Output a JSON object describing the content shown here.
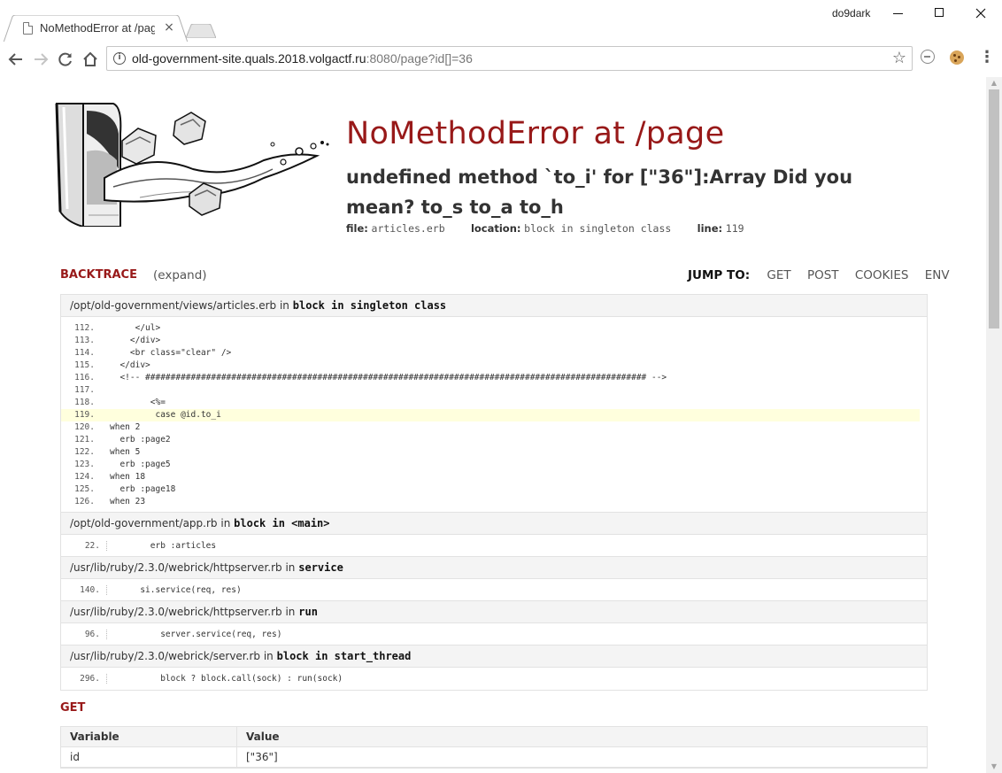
{
  "browser": {
    "tab_title": "NoMethodError at /page",
    "tab_close": "×",
    "user": "do9dark",
    "url_host": "old-government-site.quals.2018.volgactf.ru",
    "url_rest": ":8080/page?id[]=36"
  },
  "error": {
    "title": "NoMethodError at /page",
    "message": "undefined method `to_i' for [\"36\"]:Array Did you mean? to_s to_a to_h",
    "file_label": "file:",
    "file": "articles.erb",
    "location_label": "location:",
    "location": "block in singleton class",
    "line_label": "line:",
    "line": "119"
  },
  "backtrace": {
    "heading": "BACKTRACE",
    "expand": "(expand)",
    "jump_label": "JUMP TO:",
    "jump_links": [
      "GET",
      "POST",
      "COOKIES",
      "ENV"
    ],
    "frames": [
      {
        "file": "/opt/old-government/views/articles.erb",
        "in": "in",
        "method": "block in singleton class",
        "lines": [
          {
            "no": "112.",
            "code": "     </ul>"
          },
          {
            "no": "113.",
            "code": "    </div>"
          },
          {
            "no": "114.",
            "code": "    <br class=\"clear\" />"
          },
          {
            "no": "115.",
            "code": "  </div>"
          },
          {
            "no": "116.",
            "code": "  <!-- ################################################################################################### -->"
          },
          {
            "no": "117.",
            "code": ""
          },
          {
            "no": "118.",
            "code": "        <%="
          },
          {
            "no": "119.",
            "code": "         case @id.to_i"
          },
          {
            "no": "120.",
            "code": "when 2"
          },
          {
            "no": "121.",
            "code": "  erb :page2"
          },
          {
            "no": "122.",
            "code": "when 5"
          },
          {
            "no": "123.",
            "code": "  erb :page5"
          },
          {
            "no": "124.",
            "code": "when 18"
          },
          {
            "no": "125.",
            "code": "  erb :page18"
          },
          {
            "no": "126.",
            "code": "when 23"
          }
        ]
      },
      {
        "file": "/opt/old-government/app.rb",
        "in": "in",
        "method": "block in <main>",
        "line_no": "22.",
        "code": "        erb :articles"
      },
      {
        "file": "/usr/lib/ruby/2.3.0/webrick/httpserver.rb",
        "in": "in",
        "method": "service",
        "line_no": "140.",
        "code": "      si.service(req, res)"
      },
      {
        "file": "/usr/lib/ruby/2.3.0/webrick/httpserver.rb",
        "in": "in",
        "method": "run",
        "line_no": "96.",
        "code": "          server.service(req, res)"
      },
      {
        "file": "/usr/lib/ruby/2.3.0/webrick/server.rb",
        "in": "in",
        "method": "block in start_thread",
        "line_no": "296.",
        "code": "          block ? block.call(sock) : run(sock)"
      }
    ]
  },
  "get": {
    "heading": "GET",
    "columns": [
      "Variable",
      "Value"
    ],
    "rows": [
      [
        "id",
        "[\"36\"]"
      ]
    ]
  },
  "colors": {
    "accent": "#981919",
    "highlight": "#ffffdd",
    "header_bg": "#f4f4f4"
  }
}
